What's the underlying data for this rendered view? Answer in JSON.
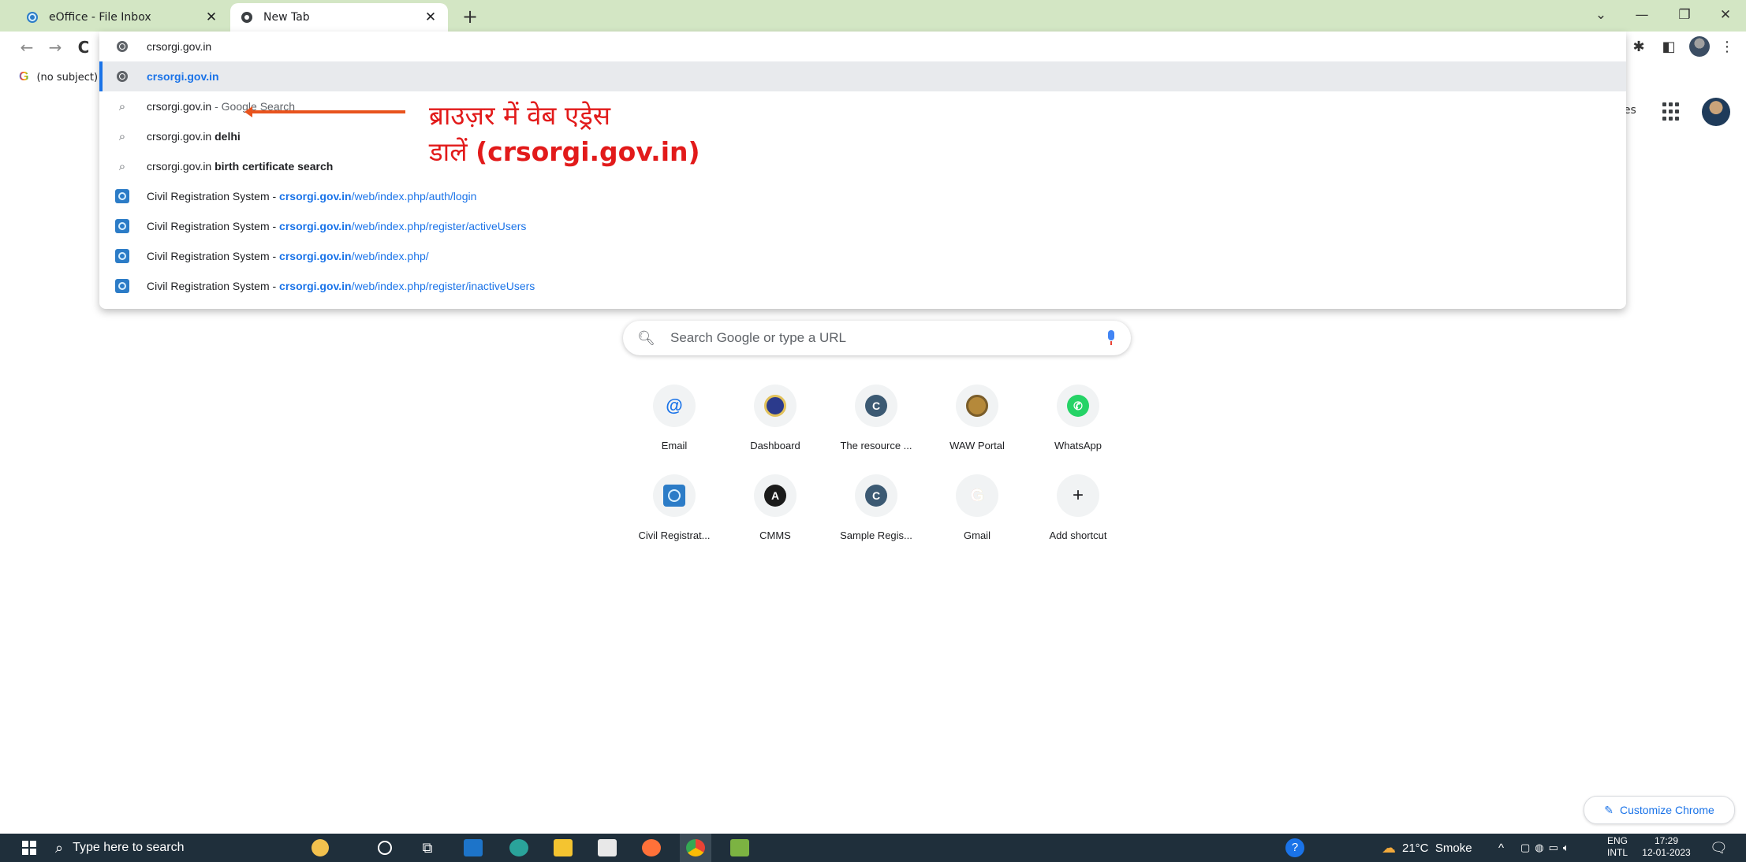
{
  "tabs": [
    {
      "title": "eOffice - File Inbox",
      "active": false
    },
    {
      "title": "New Tab",
      "active": true
    }
  ],
  "bookmarks": [
    {
      "label": "(no subject)",
      "icon": "google-g-icon"
    }
  ],
  "omnibox": {
    "input": "crsorgi.gov.in",
    "suggestions": [
      {
        "type": "url",
        "bold": "crsorgi.gov.in",
        "rest": ""
      },
      {
        "type": "search",
        "text": "crsorgi.gov.in",
        "suffix": " - Google Search"
      },
      {
        "type": "search",
        "text": "crsorgi.gov.in ",
        "bold": "delhi"
      },
      {
        "type": "search",
        "text": "crsorgi.gov.in ",
        "bold": "birth certificate search"
      },
      {
        "type": "history",
        "title": "Civil Registration System - ",
        "domain": "crsorgi.gov.in",
        "path": "/web/index.php/auth/login"
      },
      {
        "type": "history",
        "title": "Civil Registration System - ",
        "domain": "crsorgi.gov.in",
        "path": "/web/index.php/register/activeUsers"
      },
      {
        "type": "history",
        "title": "Civil Registration System - ",
        "domain": "crsorgi.gov.in",
        "path": "/web/index.php/"
      },
      {
        "type": "history",
        "title": "Civil Registration System - ",
        "domain": "crsorgi.gov.in",
        "path": "/web/index.php/register/inactiveUsers"
      }
    ]
  },
  "annotation": {
    "line1": "ब्राउज़र में वेब एड्रेस",
    "line2_prefix": "डालें ",
    "line2_bold": "(crsorgi.gov.in)"
  },
  "page": {
    "top_link": "ges",
    "search_placeholder": "Search Google or type a URL",
    "shortcuts": [
      {
        "label": "Email",
        "icon": "at-icon",
        "color": "#1a73e8"
      },
      {
        "label": "Dashboard",
        "icon": "emblem-icon",
        "color": "#2b3a8c"
      },
      {
        "label": "The resource ...",
        "icon": "c-letter-icon",
        "color": "#3c5a73"
      },
      {
        "label": "WAW Portal",
        "icon": "waw-portal-icon",
        "color": "#b5893a"
      },
      {
        "label": "WhatsApp",
        "icon": "whatsapp-icon",
        "color": "#25d366"
      },
      {
        "label": "Civil Registrat...",
        "icon": "crs-icon",
        "color": "#2c7cc7"
      },
      {
        "label": "CMMS",
        "icon": "angular-icon",
        "color": "#1b1b1b"
      },
      {
        "label": "Sample Regis...",
        "icon": "c-letter-icon",
        "color": "#3c5a73"
      },
      {
        "label": "Gmail",
        "icon": "google-g-icon",
        "color": "#4285f4"
      },
      {
        "label": "Add shortcut",
        "icon": "plus-icon",
        "color": "#202124"
      }
    ],
    "customize_label": "Customize Chrome"
  },
  "taskbar": {
    "search_placeholder": "Type here to search",
    "weather": "21°C  Smoke",
    "lang_top": "ENG",
    "lang_bottom": "INTL",
    "time": "17:29",
    "date": "12-01-2023"
  }
}
